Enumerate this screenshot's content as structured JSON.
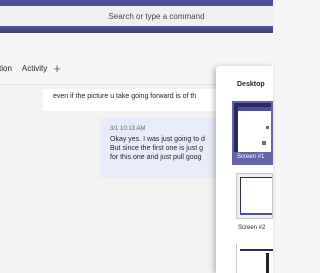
{
  "search": {
    "placeholder": "Search or type a command"
  },
  "tabs": [
    {
      "label": "tion"
    },
    {
      "label": "Activity"
    }
  ],
  "add_tab": {
    "icon": "plus-icon",
    "glyph": "+"
  },
  "messages": {
    "top_text": "even if the picture u take going forward is of th",
    "card": {
      "time": "3/1 10:13 AM",
      "lines": [
        "Okay yes. I was just going to d",
        "But since the first one is just g",
        "for this one and just pull goog"
      ]
    }
  },
  "share_panel": {
    "title": "Desktop",
    "screens": [
      {
        "label": "Screen #1",
        "selected": true
      },
      {
        "label": "Screen #2",
        "selected": false
      }
    ]
  },
  "colors": {
    "title_bar": "#4b4f99",
    "accent": "#6264a7",
    "message_card": "#e8ebfa"
  }
}
